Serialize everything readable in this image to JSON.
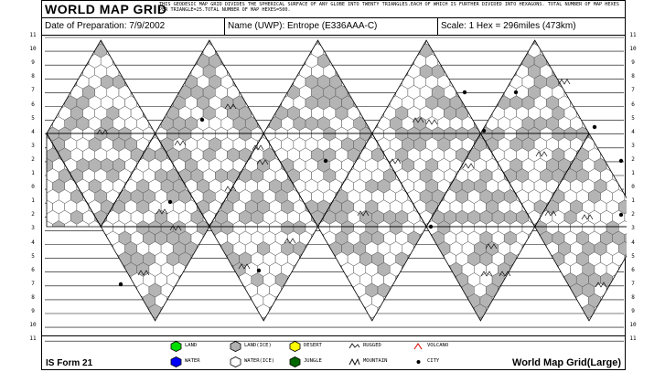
{
  "header": {
    "title": "WORLD MAP GRID",
    "description": "THIS GEODESIC MAP GRID DIVIDES THE SPHERICAL SURFACE OF ANY GLOBE INTO TWENTY TRIANGLES.EACH OF WHICH IS FURTHER DIVIDED INTO HEXAGONS. TOTAL NUMBER OF MAP HEXES PER TRIANGLE=25.TOTAL NUMBER OF MAP HEXES=500."
  },
  "info": {
    "date": "Date of Preparation: 7/9/2002",
    "name": "Name (UWP): Entrope (E336AAA-C)",
    "scale": "Scale: 1 Hex = 296miles (473km)"
  },
  "row_labels": [
    "11",
    "10",
    "9",
    "8",
    "7",
    "6",
    "5",
    "4",
    "3",
    "2",
    "1",
    "0",
    "1",
    "2",
    "3",
    "4",
    "5",
    "6",
    "7",
    "8",
    "9",
    "10",
    "11"
  ],
  "legend": {
    "items": [
      {
        "label": "LAND",
        "color": "#00dd00",
        "icon": "land-hex-icon"
      },
      {
        "label": "WATER",
        "color": "#0000ff",
        "icon": "water-hex-icon"
      },
      {
        "label": "LAND(ICE)",
        "color": "#b0b0b0",
        "icon": "land-ice-hex-icon"
      },
      {
        "label": "WATER(ICE)",
        "color": "#ffffff",
        "icon": "water-ice-hex-icon"
      },
      {
        "label": "DESERT",
        "color": "#ffff00",
        "icon": "desert-hex-icon"
      },
      {
        "label": "JUNGLE",
        "color": "#006600",
        "icon": "jungle-hex-icon"
      },
      {
        "label": "RUGGED",
        "icon": "rugged-icon"
      },
      {
        "label": "MOUNTAIN",
        "icon": "mountain-icon"
      },
      {
        "label": "VOLCANO",
        "icon": "volcano-icon"
      },
      {
        "label": "CITY",
        "icon": "city-icon"
      }
    ],
    "form": "IS Form 21",
    "map_type": "World Map Grid(Large)"
  }
}
